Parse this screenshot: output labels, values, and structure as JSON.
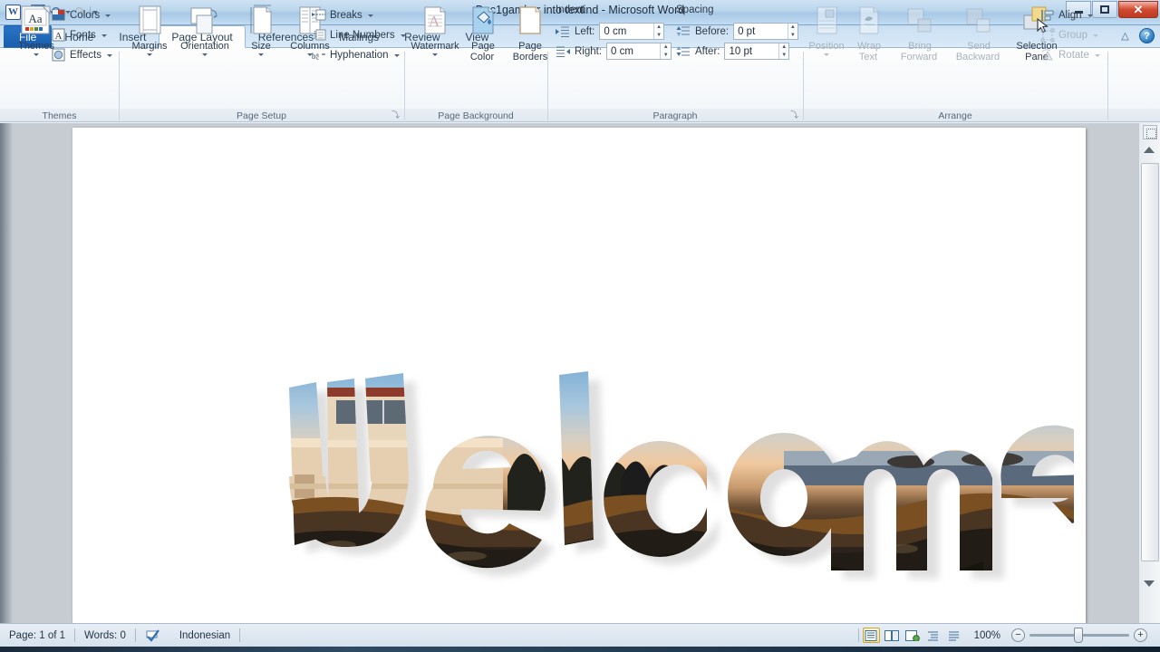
{
  "window": {
    "title": "Doc1gambar into textind  -  Microsoft Word",
    "logo_text": "W",
    "quick_access": [
      {
        "name": "save",
        "label": "Save",
        "icon": "save-icon",
        "enabled": true
      },
      {
        "name": "undo",
        "label": "Undo",
        "icon": "undo-icon",
        "glyph": "↶",
        "enabled": true
      },
      {
        "name": "redo",
        "label": "Redo",
        "icon": "redo-icon",
        "glyph": "↷",
        "enabled": false
      },
      {
        "name": "customize",
        "label": "Customize Quick Access Toolbar",
        "icon": "chevron-down-icon",
        "enabled": true
      }
    ],
    "controls": {
      "minimize": "Minimize",
      "restore": "Restore Down",
      "close": "✕"
    }
  },
  "ribbon": {
    "tabs": [
      {
        "id": "file",
        "label": "File",
        "active": false,
        "file": true
      },
      {
        "id": "home",
        "label": "Home",
        "active": false
      },
      {
        "id": "insert",
        "label": "Insert",
        "active": false
      },
      {
        "id": "page-layout",
        "label": "Page Layout",
        "active": true
      },
      {
        "id": "references",
        "label": "References",
        "active": false
      },
      {
        "id": "mailings",
        "label": "Mailings",
        "active": false
      },
      {
        "id": "review",
        "label": "Review",
        "active": false
      },
      {
        "id": "view",
        "label": "View",
        "active": false
      }
    ],
    "helpers": {
      "minimize_ribbon": "△",
      "help": "?"
    },
    "groups": {
      "themes": {
        "label": "Themes",
        "big": {
          "label": "Themes",
          "icon": "themes-icon",
          "glyph": "Aa"
        },
        "small": [
          {
            "label": "Colors",
            "icon": "theme-colors-icon",
            "enabled": true
          },
          {
            "label": "Fonts",
            "icon": "theme-fonts-icon",
            "enabled": true
          },
          {
            "label": "Effects",
            "icon": "theme-effects-icon",
            "enabled": true
          }
        ]
      },
      "page_setup": {
        "label": "Page Setup",
        "big": [
          {
            "label": "Margins",
            "icon": "margins-icon"
          },
          {
            "label": "Orientation",
            "icon": "orientation-icon"
          },
          {
            "label": "Size",
            "icon": "size-icon"
          },
          {
            "label": "Columns",
            "icon": "columns-icon"
          }
        ],
        "small": [
          {
            "label": "Breaks",
            "icon": "breaks-icon",
            "enabled": true
          },
          {
            "label": "Line Numbers",
            "icon": "line-numbers-icon",
            "enabled": true
          },
          {
            "label": "Hyphenation",
            "icon": "hyphenation-icon",
            "enabled": true
          }
        ],
        "dialog_launcher": "⤵"
      },
      "page_background": {
        "label": "Page Background",
        "big": [
          {
            "label": "Watermark",
            "icon": "watermark-icon",
            "caret": true
          },
          {
            "label": "Page",
            "label2": "Color",
            "icon": "page-color-icon",
            "caret": true
          },
          {
            "label": "Page",
            "label2": "Borders",
            "icon": "page-borders-icon",
            "caret": false
          }
        ]
      },
      "paragraph": {
        "label": "Paragraph",
        "indent_title": "Indent",
        "spacing_title": "Spacing",
        "fields": [
          {
            "label": "Left:",
            "value": "0 cm",
            "icon": "indent-left-icon"
          },
          {
            "label": "Right:",
            "value": "0 cm",
            "icon": "indent-right-icon"
          },
          {
            "label": "Before:",
            "value": "0 pt",
            "icon": "spacing-before-icon"
          },
          {
            "label": "After:",
            "value": "10 pt",
            "icon": "spacing-after-icon"
          }
        ],
        "dialog_launcher": "⤵"
      },
      "arrange": {
        "label": "Arrange",
        "big": [
          {
            "label": "Position",
            "icon": "position-icon",
            "enabled": false,
            "caret": true
          },
          {
            "label": "Wrap",
            "label2": "Text",
            "icon": "wrap-text-icon",
            "enabled": false,
            "caret": true
          },
          {
            "label": "Bring",
            "label2": "Forward",
            "icon": "bring-forward-icon",
            "enabled": false,
            "caret": true
          },
          {
            "label": "Send",
            "label2": "Backward",
            "icon": "send-backward-icon",
            "enabled": false,
            "caret": true
          },
          {
            "label": "Selection",
            "label2": "Pane",
            "icon": "selection-pane-icon",
            "enabled": true,
            "caret": false
          }
        ],
        "small": [
          {
            "label": "Align",
            "icon": "align-icon",
            "enabled": true
          },
          {
            "label": "Group",
            "icon": "group-icon",
            "enabled": false
          },
          {
            "label": "Rotate",
            "icon": "rotate-icon",
            "enabled": false
          }
        ]
      }
    }
  },
  "document": {
    "artwork": {
      "name": "welcome-picture-text",
      "text": "Welcome",
      "description": "Word art text filled with a coastal sunset photograph",
      "letters": [
        "W",
        "e",
        "l",
        "c",
        "o",
        "m",
        "e"
      ],
      "image_colors": {
        "sky_top": "#8fb8d8",
        "sky_mid": "#c9cdd0",
        "sunset_glow": "#f0c9a0",
        "building": "#e8d3b6",
        "building_roof": "#8d3a2a",
        "rock_dark": "#231d18",
        "rock_warm": "#6f4a22",
        "sea": "#4b5a6a",
        "shadow": "#c9c9c9"
      }
    }
  },
  "statusbar": {
    "page": "Page: 1 of 1",
    "words": "Words: 0",
    "language": "Indonesian",
    "proofing_icon": "proofing-errors-icon",
    "views": [
      {
        "name": "print-layout",
        "label": "Print Layout",
        "selected": true
      },
      {
        "name": "full-screen-reading",
        "label": "Full Screen Reading",
        "selected": false
      },
      {
        "name": "web-layout",
        "label": "Web Layout",
        "selected": false
      },
      {
        "name": "outline",
        "label": "Outline",
        "selected": false
      },
      {
        "name": "draft",
        "label": "Draft",
        "selected": false
      }
    ],
    "zoom": {
      "level": "100%",
      "out": "−",
      "in": "+"
    }
  }
}
